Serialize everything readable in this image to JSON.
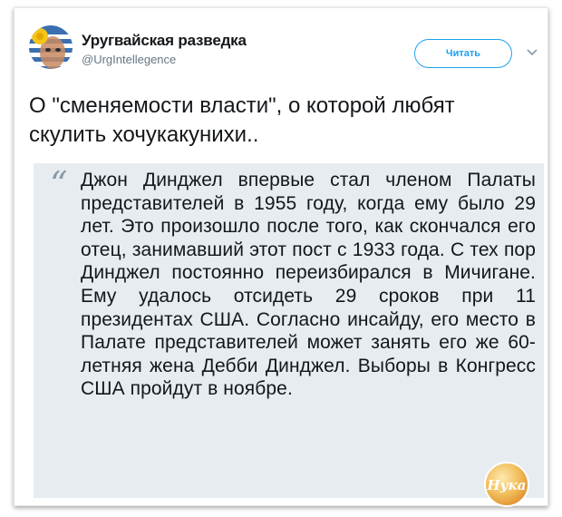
{
  "account": {
    "name": "Уругвайская разведка",
    "handle": "@UrgIntellegence"
  },
  "follow_button": {
    "label": "Читать"
  },
  "tweet": {
    "text": "О \"сменяемости власти\", о которой любят скулить хочукакунихи..",
    "quote_mark": "“",
    "quote": "Джон Динджел впервые стал членом Палаты представителей в 1955 году, когда ему было 29 лет. Это произошло после того, как скончался его отец, занимавший этот пост с 1933 года. С тех пор Динджел постоянно переизбирался в Мичигане. Ему удалось отсидеть 29 сроков при 11 президентах США. Согласно инсайду, его место в Палате представителей может занять его же 60-летняя жена Дебби Динджел. Выборы в Конгресс США пройдут в ноябре."
  },
  "watermark": {
    "text": "Нука"
  },
  "colors": {
    "accent": "#1da1f2",
    "quote_background": "#e6ecf0",
    "muted": "#657786"
  },
  "icons": {
    "avatar": "uruguay-flag-face-avatar",
    "menu": "chevron-down-icon"
  }
}
